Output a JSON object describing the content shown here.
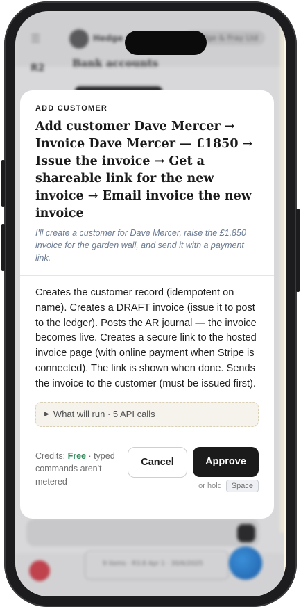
{
  "background": {
    "company_name": "Hedge & Gale",
    "company_pill": "Hedge & Fray Ltd",
    "section_badge": "R2",
    "section_title": "Bank accounts",
    "bottom_text": "9 items · R3.8    Apr 1 · 30/6/2025"
  },
  "modal": {
    "eyebrow": "ADD CUSTOMER",
    "title": "Add customer Dave Mercer → Invoice Dave Mercer — £1850 → Issue the invoice → Get a shareable link for the new invoice → Email invoice the new invoice",
    "subtitle": "I'll create a customer for Dave Mercer, raise the £1,850 invoice for the garden wall, and send it with a payment link.",
    "description": "Creates the customer record (idempotent on name). Creates a DRAFT invoice (issue it to post to the ledger). Posts the AR journal — the invoice becomes live. Creates a secure link to the hosted invoice page (with online payment when Stripe is connected). The link is shown when done. Sends the invoice to the customer (must be issued first).",
    "details_summary": "What will run · 5 API calls",
    "credits_label": "Credits:",
    "credits_value": "Free",
    "credits_note": "· typed commands aren't metered",
    "cancel_label": "Cancel",
    "approve_label": "Approve",
    "hold_label": "or hold",
    "hold_key": "Space"
  },
  "colors": {
    "credits_free": "#2f8a5a",
    "approve_bg": "#1b1b1b",
    "subtitle": "#6a7a92"
  }
}
